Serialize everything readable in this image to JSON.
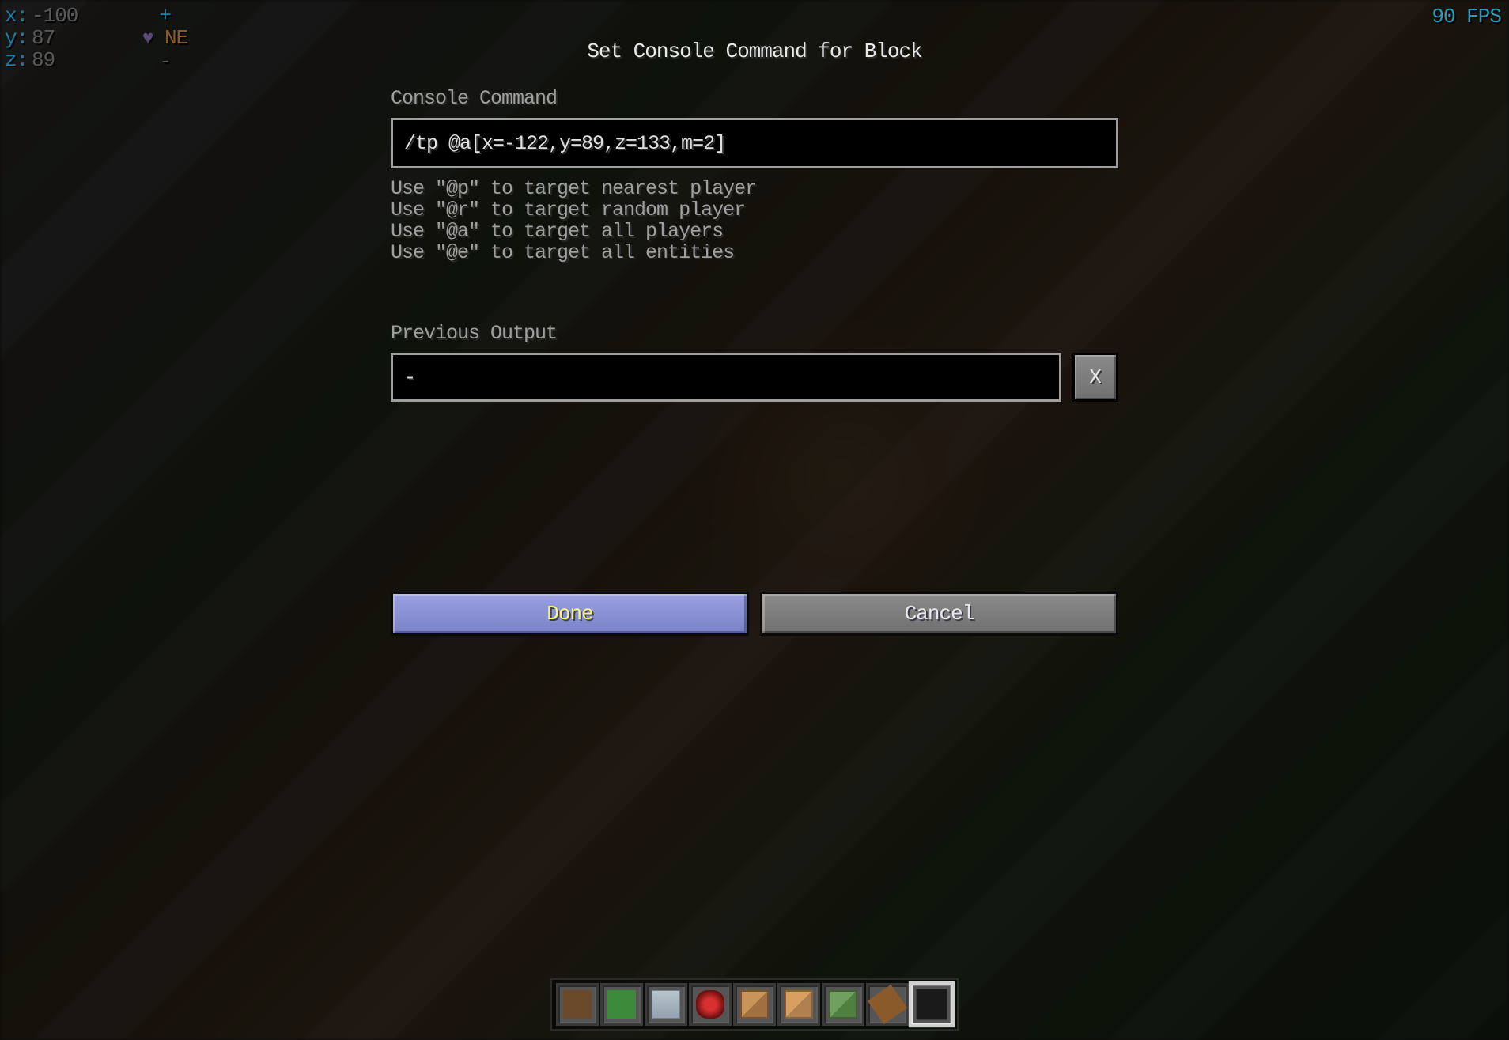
{
  "hud": {
    "coords": {
      "x_label": "x:",
      "x": "-100",
      "y_label": "y:",
      "y": "87",
      "z_label": "z:",
      "z": "89"
    },
    "plus": "+",
    "heart": "♥",
    "direction": "NE",
    "minus": "-",
    "fps": "90 FPS"
  },
  "gui": {
    "title": "Set Console Command for Block",
    "command_label": "Console Command",
    "command_value": "/tp @a[x=-122,y=89,z=133,m=2]",
    "hints": [
      "Use \"@p\" to target nearest player",
      "Use \"@r\" to target random player",
      "Use \"@a\" to target all players",
      "Use \"@e\" to target all entities"
    ],
    "previous_label": "Previous Output",
    "previous_value": "-",
    "track_button": "X",
    "done": "Done",
    "cancel": "Cancel"
  },
  "hotbar": {
    "selected_index": 8,
    "slots": [
      {
        "item": "brown_wool"
      },
      {
        "item": "green_wool"
      },
      {
        "item": "glass"
      },
      {
        "item": "redstone"
      },
      {
        "item": "command_block"
      },
      {
        "item": "command_block_2"
      },
      {
        "item": "command_block_3"
      },
      {
        "item": "stick"
      },
      {
        "item": "dark"
      }
    ]
  }
}
